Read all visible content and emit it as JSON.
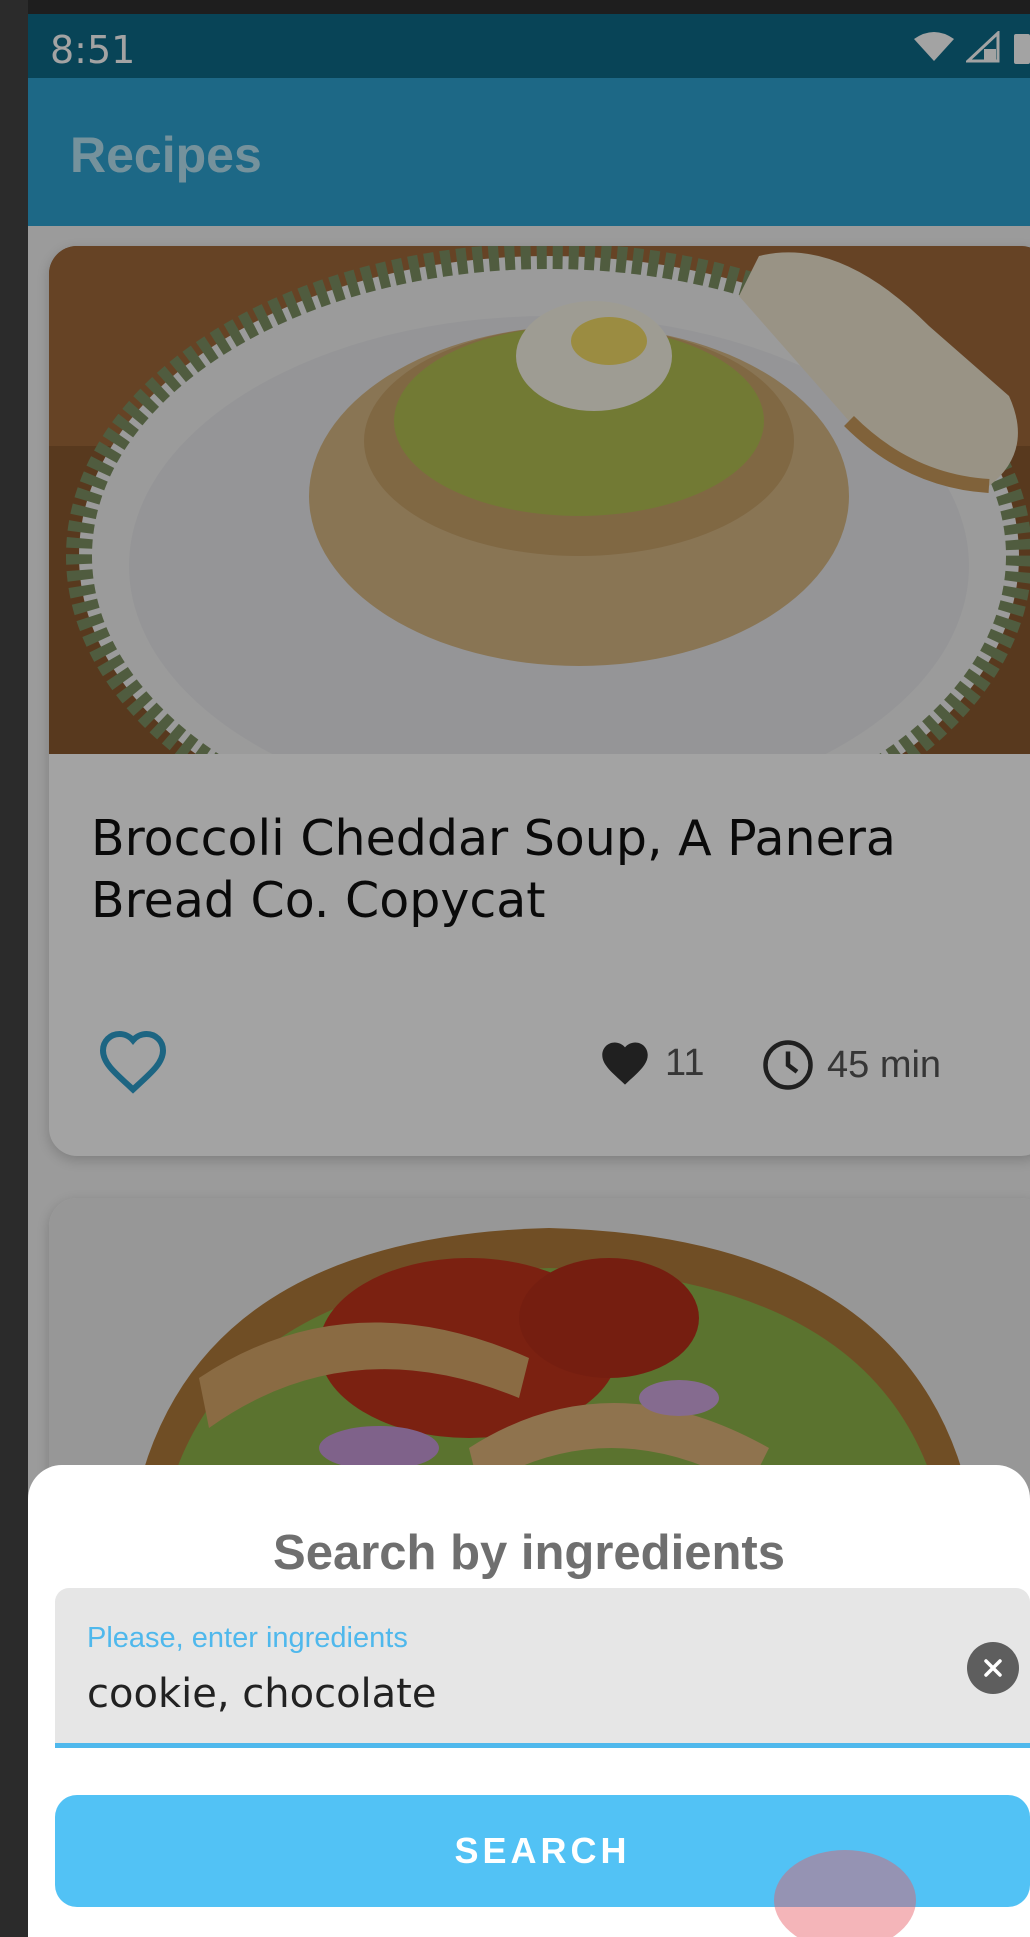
{
  "status_bar": {
    "time": "8:51"
  },
  "app_bar": {
    "title": "Recipes"
  },
  "recipes": [
    {
      "title": "Broccoli Cheddar Soup, A Panera Bread Co. Copycat",
      "likes": "11",
      "time": "45 min"
    }
  ],
  "search_sheet": {
    "title": "Search by ingredients",
    "input_label": "Please, enter ingredients",
    "input_value": "cookie, chocolate",
    "search_button": "SEARCH"
  },
  "icons": {
    "favorite": "heart-outline-icon",
    "likes": "heart-filled-icon",
    "time": "clock-icon",
    "clear": "clear-circle-icon",
    "wifi": "wifi-icon",
    "signal": "signal-icon",
    "battery": "battery-icon"
  },
  "colors": {
    "status_bar": "#0e6b88",
    "app_bar": "#2ea3d2",
    "accent": "#52c2f5",
    "field_underline": "#4fb8ec"
  }
}
